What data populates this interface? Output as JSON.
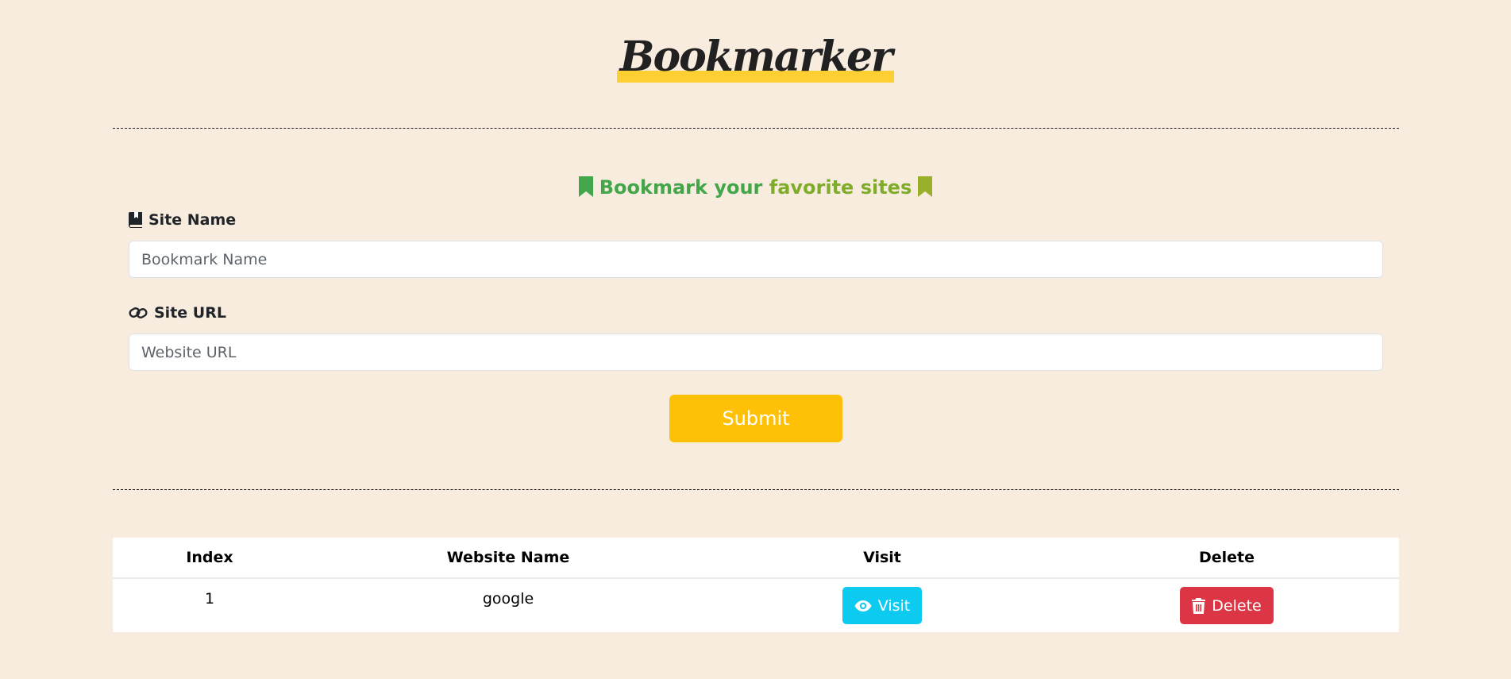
{
  "header": {
    "logo_text": "Bookmarker"
  },
  "form": {
    "heading_part1": "Bookmark your",
    "heading_part2": "favorite sites",
    "site_name_label": "Site Name",
    "site_name_placeholder": "Bookmark Name",
    "site_url_label": "Site URL",
    "site_url_placeholder": "Website URL",
    "submit_label": "Submit"
  },
  "table": {
    "headers": [
      "Index",
      "Website Name",
      "Visit",
      "Delete"
    ],
    "rows": [
      {
        "index": "1",
        "name": "google",
        "visit_label": "Visit",
        "delete_label": "Delete"
      }
    ]
  },
  "colors": {
    "background": "#f8ecdf",
    "logo_highlight": "#fdcf33",
    "heading_green": "#44a64a",
    "heading_olive": "#7fac2b",
    "submit": "#ffc107",
    "visit": "#0dcaf0",
    "delete": "#dc3545"
  },
  "icons": {
    "heading_left": "bookmark-icon",
    "heading_right": "bookmark-icon",
    "site_name": "book-bookmark-icon",
    "site_url": "link-icon",
    "visit": "eye-icon",
    "delete": "trash-icon"
  }
}
